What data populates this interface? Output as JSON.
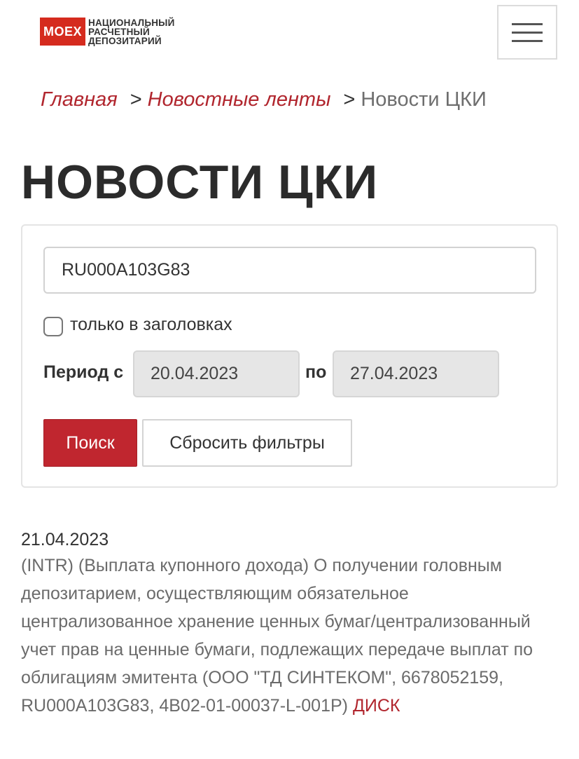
{
  "header": {
    "logo_mark": "MOEX",
    "logo_line1": "Национальный",
    "logo_line2": "расчетный",
    "logo_line3": "депозитарий",
    "menu_icon": "hamburger-icon"
  },
  "breadcrumb": {
    "home": "Главная",
    "separator": ">",
    "section": "Новостные ленты",
    "current": "Новости ЦКИ"
  },
  "page": {
    "title": "НОВОСТИ ЦКИ"
  },
  "filters": {
    "search_value": "RU000A103G83",
    "titles_only_label": "только в заголовках",
    "titles_only_checked": false,
    "period_from_label": "Период с",
    "date_from": "20.04.2023",
    "period_to_label": "по",
    "date_to": "27.04.2023",
    "search_button": "Поиск",
    "reset_button": "Сбросить фильтры"
  },
  "news": [
    {
      "date": "21.04.2023",
      "text": "(INTR) (Выплата купонного дохода) О получении головным депозитарием, осуществляющим обязательное централизованное хранение ценных бумаг/централизованный учет прав на ценные бумаги, подлежащих передаче выплат по облигациям эмитента (ООО \"ТД СИНТЕКОМ\", 6678052159, RU000A103G83, 4B02-01-00037-L-001P)",
      "link_label": "ДИСК"
    }
  ],
  "colors": {
    "brand_red": "#d52b1e",
    "link_red": "#b1262e",
    "button_red": "#c0262f"
  }
}
